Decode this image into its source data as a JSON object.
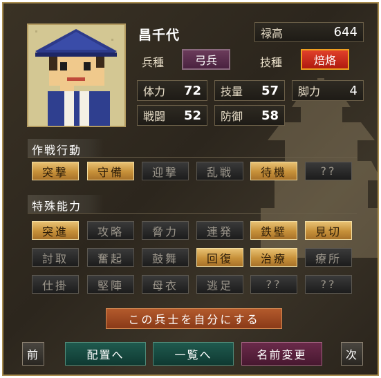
{
  "character": {
    "name": "昌千代",
    "stipend_label": "禄高",
    "stipend_value": "644",
    "troop_type_label": "兵種",
    "troop_type_value": "弓兵",
    "skill_type_label": "技種",
    "skill_type_value": "焙烙"
  },
  "stats": [
    {
      "label": "体力",
      "value": "72"
    },
    {
      "label": "技量",
      "value": "57"
    },
    {
      "label": "脚力",
      "value": "4"
    },
    {
      "label": "戦闘",
      "value": "52"
    },
    {
      "label": "防御",
      "value": "58"
    }
  ],
  "tactics": {
    "title": "作戦行動",
    "items": [
      {
        "label": "突撃",
        "active": true
      },
      {
        "label": "守備",
        "active": true
      },
      {
        "label": "迎撃",
        "active": false
      },
      {
        "label": "乱戦",
        "active": false
      },
      {
        "label": "待機",
        "active": true
      },
      {
        "label": "??",
        "active": false
      }
    ]
  },
  "abilities": {
    "title": "特殊能力",
    "items": [
      {
        "label": "突進",
        "active": true
      },
      {
        "label": "攻略",
        "active": false
      },
      {
        "label": "脅力",
        "active": false
      },
      {
        "label": "連発",
        "active": false
      },
      {
        "label": "鉄壁",
        "active": true
      },
      {
        "label": "見切",
        "active": true
      },
      {
        "label": "討取",
        "active": false
      },
      {
        "label": "奮起",
        "active": false
      },
      {
        "label": "鼓舞",
        "active": false
      },
      {
        "label": "回復",
        "active": true
      },
      {
        "label": "治療",
        "active": true
      },
      {
        "label": "療所",
        "active": false
      },
      {
        "label": "仕掛",
        "active": false
      },
      {
        "label": "堅陣",
        "active": false
      },
      {
        "label": "母衣",
        "active": false
      },
      {
        "label": "逃足",
        "active": false
      },
      {
        "label": "??",
        "active": false
      },
      {
        "label": "??",
        "active": false
      }
    ]
  },
  "actions": {
    "make_own": "この兵士を自分にする",
    "prev": "前",
    "placement": "配置へ",
    "list": "一覧へ",
    "rename": "名前変更",
    "next": "次"
  },
  "colors": {
    "active_button": "#d4a24e",
    "inactive_button": "#262626",
    "troop_tag": "#5a2e4e",
    "skill_tag": "#d02a1a",
    "make_own_button": "#9e4a22",
    "nav_teal": "#17483e",
    "nav_maroon": "#5a2040"
  }
}
